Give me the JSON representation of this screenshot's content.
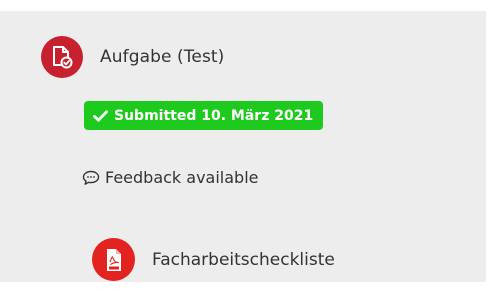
{
  "activity": {
    "icon": "assignment-submission-icon",
    "title": "Aufgabe (Test)",
    "status_badge": "Submitted 10. März 2021",
    "status_color": "#1fca1f",
    "feedback_text": "Feedback available",
    "accent_color": "#c7202e"
  },
  "resource": {
    "icon": "pdf-file-icon",
    "title": "Facharbeitscheckliste",
    "accent_color": "#e3231f"
  }
}
